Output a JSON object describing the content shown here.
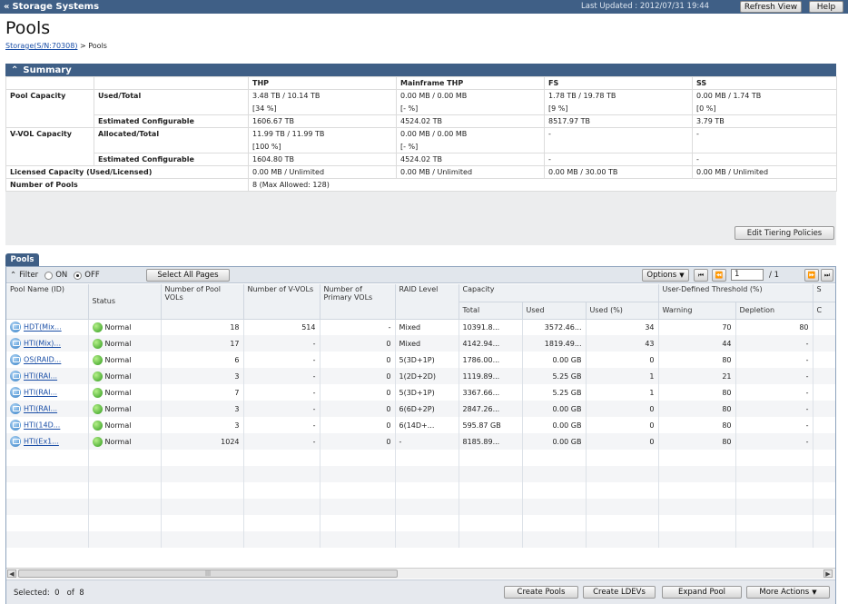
{
  "topbar": {
    "back_label": "Storage Systems",
    "last_updated": "Last Updated : 2012/07/31 19:44",
    "refresh_label": "Refresh View",
    "help_label": "Help"
  },
  "page": {
    "title": "Pools",
    "breadcrumb_link": "Storage(S/N:70308)",
    "breadcrumb_sep": " > ",
    "breadcrumb_current": "Pools"
  },
  "summary": {
    "title": "Summary",
    "headers": [
      "",
      "",
      "THP",
      "Mainframe THP",
      "FS",
      "SS"
    ],
    "rows": [
      [
        "Pool Capacity",
        "Used/Total",
        "3.48 TB / 10.14 TB",
        "0.00 MB / 0.00 MB",
        "1.78 TB / 19.78 TB",
        "0.00 MB / 1.74 TB"
      ],
      [
        "",
        "",
        "[34 %]",
        "[- %]",
        "[9 %]",
        "[0 %]"
      ],
      [
        "",
        "Estimated Configurable",
        "1606.67 TB",
        "4524.02 TB",
        "8517.97 TB",
        "3.79 TB"
      ],
      [
        "V-VOL Capacity",
        "Allocated/Total",
        "11.99 TB / 11.99 TB",
        "0.00 MB / 0.00 MB",
        "-",
        "-"
      ],
      [
        "",
        "",
        "[100 %]",
        "[- %]",
        "",
        ""
      ],
      [
        "",
        "Estimated Configurable",
        "1604.80 TB",
        "4524.02 TB",
        "-",
        "-"
      ]
    ],
    "licensed_label": "Licensed Capacity (Used/Licensed)",
    "licensed_values": [
      "0.00 MB / Unlimited",
      "0.00 MB / Unlimited",
      "0.00 MB / 30.00 TB",
      "0.00 MB / Unlimited"
    ],
    "num_pools_label": "Number of Pools",
    "num_pools_value": "8 (Max Allowed: 128)",
    "edit_tiering_label": "Edit Tiering Policies"
  },
  "pools_tab": {
    "label": "Pools",
    "filter_label": "Filter",
    "on_label": "ON",
    "off_label": "OFF",
    "select_all_label": "Select All Pages",
    "options_label": "Options",
    "page_value": "1",
    "page_total": "/ 1"
  },
  "grid": {
    "headers": {
      "pool_name": "Pool Name (ID)",
      "status": "Status",
      "num_pool_vols": "Number of Pool VOLs",
      "num_vvols": "Number of V-VOLs",
      "num_primary": "Number of Primary VOLs",
      "raid": "RAID Level",
      "capacity": "Capacity",
      "total": "Total",
      "used": "Used",
      "used_pct": "Used (%)",
      "threshold": "User-Defined Threshold (%)",
      "warning": "Warning",
      "depletion": "Depletion",
      "extra": "S",
      "extra2": "C"
    },
    "rows": [
      {
        "name": "HDT(Mix...",
        "status": "Normal",
        "pool_vols": "18",
        "vvols": "514",
        "primary": "-",
        "raid": "Mixed",
        "total": "10391.8...",
        "used": "3572.46...",
        "used_pct": "34",
        "warning": "70",
        "depletion": "80"
      },
      {
        "name": "HTI(Mix)...",
        "status": "Normal",
        "pool_vols": "17",
        "vvols": "-",
        "primary": "0",
        "raid": "Mixed",
        "total": "4142.94...",
        "used": "1819.49...",
        "used_pct": "43",
        "warning": "44",
        "depletion": "-"
      },
      {
        "name": "OS(RAID...",
        "status": "Normal",
        "pool_vols": "6",
        "vvols": "-",
        "primary": "0",
        "raid": "5(3D+1P)",
        "total": "1786.00...",
        "used": "0.00 GB",
        "used_pct": "0",
        "warning": "80",
        "depletion": "-"
      },
      {
        "name": "HTI(RAI...",
        "status": "Normal",
        "pool_vols": "3",
        "vvols": "-",
        "primary": "0",
        "raid": "1(2D+2D)",
        "total": "1119.89...",
        "used": "5.25 GB",
        "used_pct": "1",
        "warning": "21",
        "depletion": "-"
      },
      {
        "name": "HTI(RAI...",
        "status": "Normal",
        "pool_vols": "7",
        "vvols": "-",
        "primary": "0",
        "raid": "5(3D+1P)",
        "total": "3367.66...",
        "used": "5.25 GB",
        "used_pct": "1",
        "warning": "80",
        "depletion": "-"
      },
      {
        "name": "HTI(RAI...",
        "status": "Normal",
        "pool_vols": "3",
        "vvols": "-",
        "primary": "0",
        "raid": "6(6D+2P)",
        "total": "2847.26...",
        "used": "0.00 GB",
        "used_pct": "0",
        "warning": "80",
        "depletion": "-"
      },
      {
        "name": "HTI(14D...",
        "status": "Normal",
        "pool_vols": "3",
        "vvols": "-",
        "primary": "0",
        "raid": "6(14D+...",
        "total": "595.87 GB",
        "used": "0.00 GB",
        "used_pct": "0",
        "warning": "80",
        "depletion": "-"
      },
      {
        "name": "HTI(Ex1...",
        "status": "Normal",
        "pool_vols": "1024",
        "vvols": "-",
        "primary": "0",
        "raid": "-",
        "total": "8185.89...",
        "used": "0.00 GB",
        "used_pct": "0",
        "warning": "80",
        "depletion": "-"
      }
    ]
  },
  "footer": {
    "selected_label": "Selected:  0   of  8",
    "create_pools": "Create Pools",
    "create_ldevs": "Create LDEVs",
    "expand_pool": "Expand Pool",
    "more_actions": "More Actions"
  }
}
